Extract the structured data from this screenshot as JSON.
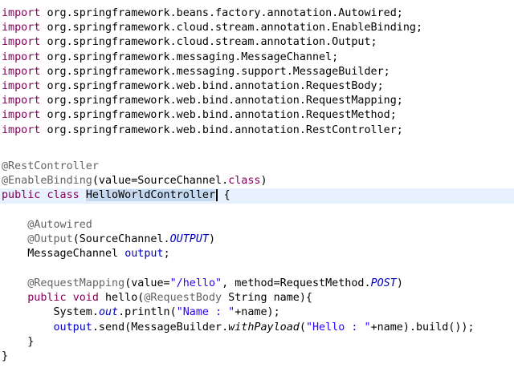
{
  "editor": {
    "language": "java",
    "imports": [
      "org.springframework.beans.factory.annotation.Autowired;",
      "org.springframework.cloud.stream.annotation.EnableBinding;",
      "org.springframework.cloud.stream.annotation.Output;",
      "org.springframework.messaging.MessageChannel;",
      "org.springframework.messaging.support.MessageBuilder;",
      "org.springframework.web.bind.annotation.RequestBody;",
      "org.springframework.web.bind.annotation.RequestMapping;",
      "org.springframework.web.bind.annotation.RequestMethod;",
      "org.springframework.web.bind.annotation.RestController;"
    ],
    "tokens": {
      "kw_import": "import",
      "kw_public": "public",
      "kw_class": "class",
      "kw_void": "void",
      "ann_rest_controller": "@RestController",
      "ann_enable_binding": "@EnableBinding",
      "enable_binding_args_prefix": "(value=SourceChannel.",
      "enable_binding_args_suffix": ")",
      "class_name": "HelloWorldController",
      "open_brace": "{",
      "ann_autowired": "@Autowired",
      "ann_output": "@Output",
      "output_args_prefix": "(SourceChannel.",
      "output_const": "OUTPUT",
      "output_args_suffix": ")",
      "field_decl_type": "MessageChannel ",
      "field_name": "output",
      "semicolon": ";",
      "ann_request_mapping": "@RequestMapping",
      "rm_args_prefix": "(value=",
      "rm_path": "\"/hello\"",
      "rm_args_middle": ", method=RequestMethod.",
      "rm_method": "POST",
      "rm_args_suffix": ")",
      "method_sig_prefix": " hello(",
      "ann_request_body": "@RequestBody",
      "method_sig_suffix": " String name){",
      "sysout_prefix": "System.",
      "sysout_field": "out",
      "sysout_call": ".println(",
      "sysout_string": "\"Name : \"",
      "sysout_suffix": "+name);",
      "send_prefix": ".send(MessageBuilder.",
      "send_static": "withPayload",
      "send_open": "(",
      "send_string": "\"Hello : \"",
      "send_suffix": "+name).build());",
      "close_brace": "}"
    }
  }
}
